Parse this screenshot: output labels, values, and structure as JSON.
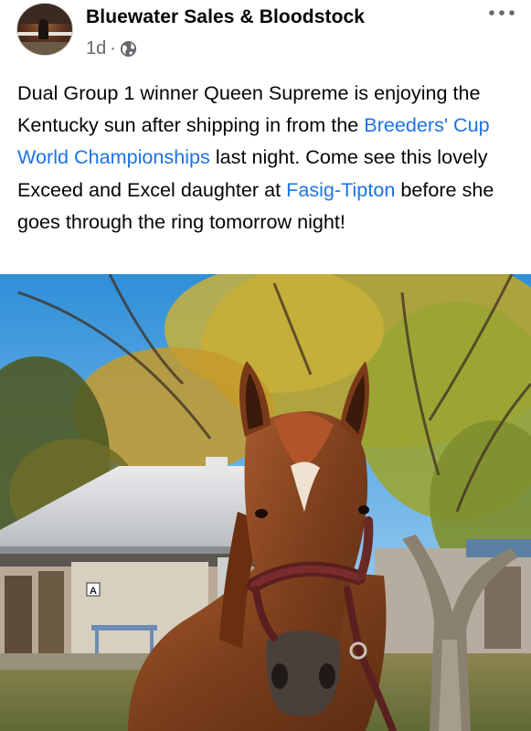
{
  "post": {
    "author": "Bluewater Sales & Bloodstock",
    "time": "1d",
    "separator": "·",
    "privacy_icon": "globe-icon",
    "more_icon": "ellipsis-icon",
    "text_segments": [
      {
        "text": "Dual Group 1 winner Queen Supreme is enjoying the Kentucky sun after shipping in from the ",
        "link": false
      },
      {
        "text": "Breeders' Cup World Championships",
        "link": true
      },
      {
        "text": " last night. Come see this lovely Exceed and Excel daughter at ",
        "link": false
      },
      {
        "text": "Fasig-Tipton",
        "link": true
      },
      {
        "text": " before she goes through the ring tomorrow night!",
        "link": false
      }
    ],
    "barn_sign": "A"
  },
  "colors": {
    "link": "#1b74e4",
    "text": "#050505",
    "meta": "#65676b"
  }
}
